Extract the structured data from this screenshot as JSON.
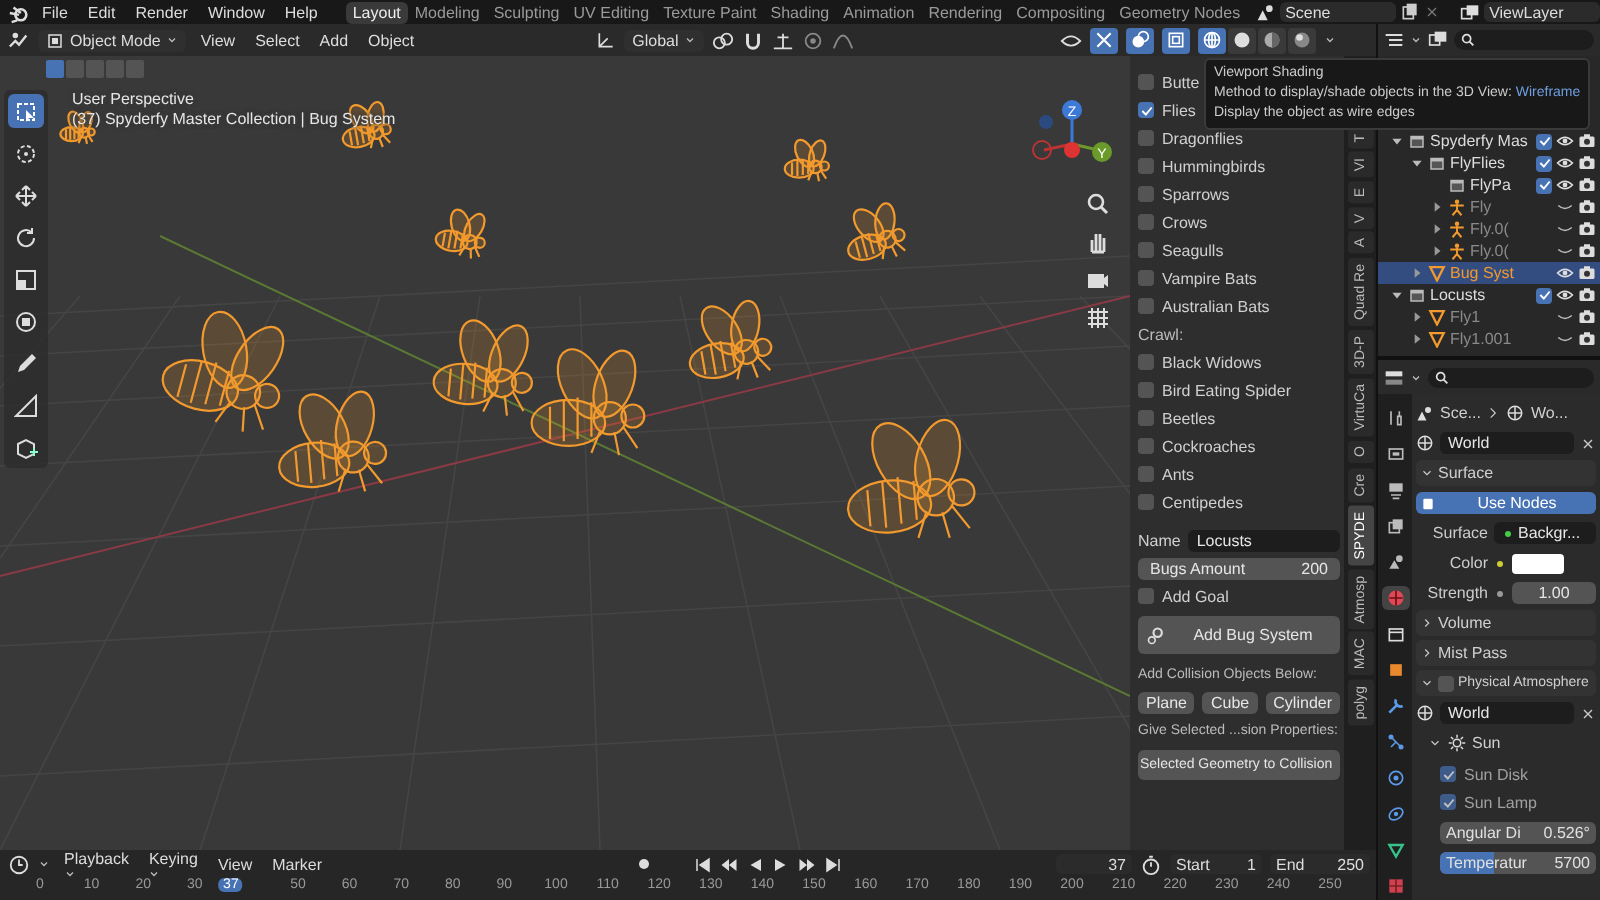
{
  "menu": [
    "File",
    "Edit",
    "Render",
    "Window",
    "Help"
  ],
  "workspaces": [
    {
      "label": "Layout",
      "selected": true
    },
    {
      "label": "Modeling",
      "selected": false
    },
    {
      "label": "Sculpting",
      "selected": false
    },
    {
      "label": "UV Editing",
      "selected": false
    },
    {
      "label": "Texture Paint",
      "selected": false
    },
    {
      "label": "Shading",
      "selected": false
    },
    {
      "label": "Animation",
      "selected": false
    },
    {
      "label": "Rendering",
      "selected": false
    },
    {
      "label": "Compositing",
      "selected": false
    },
    {
      "label": "Geometry Nodes",
      "selected": false
    }
  ],
  "scene": "Scene",
  "view_layer": "ViewLayer",
  "viewport_header": {
    "mode": "Object Mode",
    "menus": [
      "View",
      "Select",
      "Add",
      "Object"
    ],
    "orientation": "Global",
    "shading": [
      {
        "kind": "wireframe",
        "selected": true
      },
      {
        "kind": "solid",
        "selected": false
      },
      {
        "kind": "material",
        "selected": false
      },
      {
        "kind": "rendered",
        "selected": false
      }
    ]
  },
  "select_modes": [
    {
      "selected": true
    },
    {
      "selected": false
    },
    {
      "selected": false
    },
    {
      "selected": false
    },
    {
      "selected": false
    }
  ],
  "tools": [
    {
      "kind": "select",
      "selected": true
    },
    {
      "kind": "cursor",
      "selected": false
    },
    {
      "kind": "move",
      "selected": false
    },
    {
      "kind": "rotate",
      "selected": false
    },
    {
      "kind": "scale",
      "selected": false
    },
    {
      "kind": "transform",
      "selected": false
    },
    {
      "kind": "annotate",
      "selected": false
    },
    {
      "kind": "measure",
      "selected": false
    },
    {
      "kind": "add",
      "selected": false
    }
  ],
  "viewport": {
    "view_name": "User Perspective",
    "collection_info": "(37) Spyderfy Master Collection | Bug System",
    "gizmo_labels": [
      "Z",
      "Y"
    ]
  },
  "tooltip": {
    "title": "Viewport Shading",
    "description": "Method to display/shade objects in the 3D View:",
    "value": "Wireframe",
    "detail": "Display the object as wire edges"
  },
  "bug_panel": {
    "fly_options": [
      {
        "label": "Butte",
        "checked": false
      },
      {
        "label": "Flies",
        "checked": true
      },
      {
        "label": "Dragonflies",
        "checked": false
      },
      {
        "label": "Hummingbirds",
        "checked": false
      },
      {
        "label": "Sparrows",
        "checked": false
      },
      {
        "label": "Crows",
        "checked": false
      },
      {
        "label": "Seagulls",
        "checked": false
      },
      {
        "label": "Vampire Bats",
        "checked": false
      },
      {
        "label": "Australian Bats",
        "checked": false
      }
    ],
    "crawl_heading": "Crawl:",
    "crawl_options": [
      {
        "label": "Black Widows",
        "checked": false
      },
      {
        "label": "Bird Eating Spider",
        "checked": false
      },
      {
        "label": "Beetles",
        "checked": false
      },
      {
        "label": "Cockroaches",
        "checked": false
      },
      {
        "label": "Ants",
        "checked": false
      },
      {
        "label": "Centipedes",
        "checked": false
      }
    ],
    "name_label": "Name",
    "name_value": "Locusts",
    "amount_label": "Bugs Amount",
    "amount_value": "200",
    "add_goal": {
      "label": "Add Goal",
      "checked": false
    },
    "add_button": "Add Bug System",
    "collision_heading": "Add Collision Objects Below:",
    "collision_buttons": [
      "Plane",
      "Cube",
      "Cylinder"
    ],
    "give_heading": "Give Selected ...sion Properties:",
    "collision_action": "Selected Geometry to Collision"
  },
  "sidebar_tabs": [
    {
      "label": "T",
      "selected": false
    },
    {
      "label": "VI",
      "selected": false
    },
    {
      "label": "E",
      "selected": false
    },
    {
      "label": "V",
      "selected": false
    },
    {
      "label": "A",
      "selected": false
    },
    {
      "label": "Quad Re",
      "selected": false
    },
    {
      "label": "3D-P",
      "selected": false
    },
    {
      "label": "VirtuCa",
      "selected": false
    },
    {
      "label": "O",
      "selected": false
    },
    {
      "label": "Cre",
      "selected": false
    },
    {
      "label": "SPYDE",
      "selected": true
    },
    {
      "label": "Atmosp",
      "selected": false
    },
    {
      "label": "MAC",
      "selected": false
    },
    {
      "label": "polyg",
      "selected": false
    }
  ],
  "outliner": {
    "items": [
      {
        "name": "Spyderfy Mas",
        "kind": "collection",
        "expanded": true,
        "visible": true,
        "selected": false,
        "children": [
          {
            "name": "FlyFlies",
            "kind": "collection",
            "expanded": true,
            "visible": true,
            "selected": false,
            "children": [
              {
                "name": "FlyPa",
                "kind": "collection",
                "visible": true,
                "selected": false
              },
              {
                "name": "Fly",
                "kind": "armature",
                "expanded": false,
                "visible": false,
                "selected": false
              },
              {
                "name": "Fly.0(",
                "kind": "armature",
                "expanded": false,
                "visible": false,
                "selected": false
              },
              {
                "name": "Fly.0(",
                "kind": "armature",
                "expanded": false,
                "visible": false,
                "selected": false
              }
            ]
          },
          {
            "name": "Bug Syst",
            "kind": "mesh",
            "expanded": false,
            "visible": true,
            "selected": true
          }
        ]
      },
      {
        "name": "Locusts",
        "kind": "collection",
        "expanded": true,
        "visible": true,
        "selected": false,
        "children": [
          {
            "name": "Fly1",
            "kind": "mesh",
            "expanded": false,
            "visible": false,
            "selected": false
          },
          {
            "name": "Fly1.001",
            "kind": "mesh",
            "expanded": false,
            "visible": false,
            "selected": false
          }
        ]
      }
    ]
  },
  "properties": {
    "tabs": [
      {
        "kind": "tool",
        "selected": false
      },
      {
        "kind": "render",
        "selected": false
      },
      {
        "kind": "output",
        "selected": false
      },
      {
        "kind": "view-layer",
        "selected": false
      },
      {
        "kind": "scene",
        "selected": false
      },
      {
        "kind": "world",
        "selected": true
      },
      {
        "kind": "collection",
        "selected": false
      },
      {
        "kind": "object",
        "selected": false
      },
      {
        "kind": "modifier",
        "selected": false
      },
      {
        "kind": "particles",
        "selected": false
      },
      {
        "kind": "physics",
        "selected": false
      },
      {
        "kind": "constraints",
        "selected": false
      },
      {
        "kind": "data",
        "selected": false
      },
      {
        "kind": "texture",
        "selected": false
      }
    ],
    "breadcrumb": [
      "Sce...",
      "Wo..."
    ],
    "world": "World",
    "surface": {
      "title": "Surface",
      "expanded": true,
      "use_nodes": "Use Nodes",
      "surface_label": "Surface",
      "surface_value": "Backgr...",
      "color_label": "Color",
      "strength_label": "Strength",
      "strength_value": "1.00"
    },
    "collapsed_panels": [
      {
        "title": "Volume",
        "expanded": false
      },
      {
        "title": "Mist Pass",
        "expanded": false
      }
    ],
    "atmosphere": {
      "title": "Physical Atmosphere",
      "enabled": false,
      "expanded": true,
      "world": "World",
      "sun_title": "Sun",
      "sun_expanded": true,
      "options": [
        {
          "label": "Sun Disk",
          "checked": true
        },
        {
          "label": "Sun Lamp",
          "checked": true
        }
      ],
      "fields": [
        {
          "label": "Angular Di",
          "value": "0.526°",
          "level": 0
        },
        {
          "label": "Temperatur",
          "value": "5700",
          "level": 0.35
        }
      ]
    }
  },
  "timeline": {
    "menus": [
      "Playback",
      "Keying",
      "View",
      "Marker"
    ],
    "current_frame": "37",
    "start_label": "Start",
    "start": "1",
    "end_label": "End",
    "end": "250",
    "ruler": [
      "0",
      "10",
      "20",
      "30",
      "50",
      "60",
      "70",
      "80",
      "90",
      "100",
      "110",
      "120",
      "130",
      "140",
      "150",
      "160",
      "170",
      "180",
      "190",
      "200",
      "210",
      "220",
      "230",
      "240",
      "250"
    ],
    "ruler_current": "37"
  }
}
